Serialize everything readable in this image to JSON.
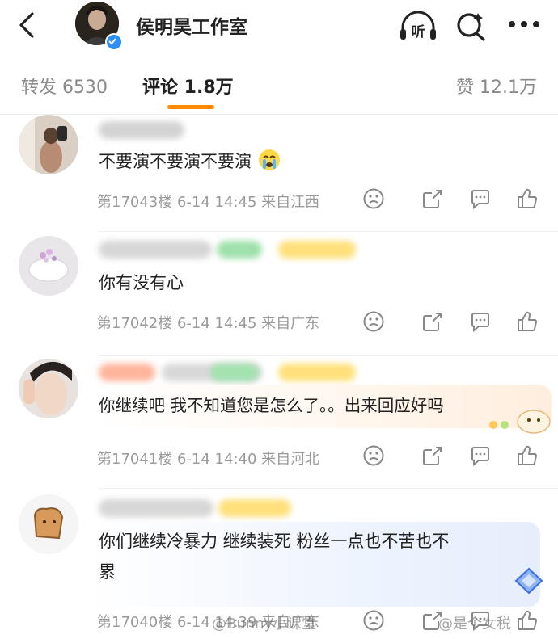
{
  "header": {
    "title": "侯明昊工作室",
    "listen_label": "听"
  },
  "tabs": {
    "repost": "转发 6530",
    "comment": "评论 1.8万",
    "like": "赞 12.1万"
  },
  "comments": [
    {
      "text": "不要演不要演不要演",
      "meta": "第17043楼  6-14 14:45  来自江西"
    },
    {
      "text": "你有没有心",
      "meta": "第17042楼  6-14 14:45  来自广东"
    },
    {
      "text": "你继续吧 我不知道您是怎么了。。出来回应好吗",
      "meta": "第17041楼  6-14 14:40  来自河北"
    },
    {
      "text_line1": "你们继续冷暴力 继续装死 粉丝一点也不苦也不",
      "text_line2": "累",
      "meta": "第17040楼  6-14 14:39  来自广东"
    }
  ],
  "watermarks": {
    "left": "@Bunny小课堂",
    "right": "@是个女税"
  },
  "colors": {
    "accent": "#ff8a00",
    "verify": "#2f8ff5",
    "meta": "#9a9a9a"
  }
}
